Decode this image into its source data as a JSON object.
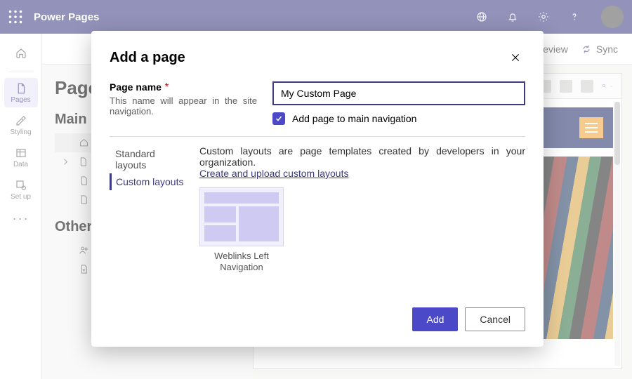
{
  "header": {
    "app_title": "Power Pages"
  },
  "toprow": {
    "preview": "eview",
    "sync": "Sync"
  },
  "rail": {
    "pages": "Pages",
    "styling": "Styling",
    "data": "Data",
    "setup": "Set up"
  },
  "pages_panel": {
    "title": "Page",
    "section_main": "Main ",
    "section_other": "Other"
  },
  "tree": {
    "home_label": "",
    "row2_label": "",
    "row3_label": "",
    "row4_label": ""
  },
  "modal": {
    "title": "Add a page",
    "field_label": "Page name",
    "required": "*",
    "field_hint": "This name will appear in the site navigation.",
    "input_value": "My Custom Page",
    "checkbox_label": "Add page to main navigation",
    "tabs": {
      "standard": "Standard layouts",
      "custom": "Custom layouts"
    },
    "body_text": "Custom layouts are page templates created by developers in your organization.",
    "link_text": "Create and upload custom layouts",
    "template_name": "Weblinks Left Navigation",
    "add": "Add",
    "cancel": "Cancel"
  }
}
